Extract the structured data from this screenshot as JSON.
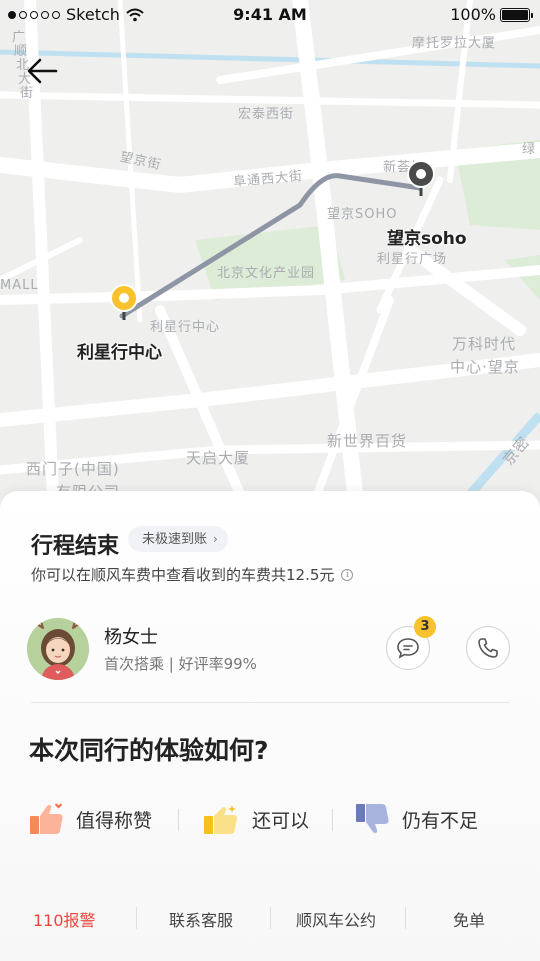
{
  "status_bar": {
    "carrier": "Sketch",
    "time": "9:41 AM",
    "battery": "100%"
  },
  "icons": {
    "back": "arrow-left-icon",
    "chat": "chat-bubble-icon",
    "phone": "phone-icon",
    "info": "info-icon",
    "praise": "thumbs-up-icon",
    "ok": "ok-hand-icon",
    "lacking": "thumbs-down-icon"
  },
  "map": {
    "labels": {
      "motorola": "摩托罗拉大厦",
      "hongtai": "宏泰西街",
      "wangjing_st": "望京街",
      "futong": "阜通西大街",
      "wangjing_soho_road": "望京SOHO",
      "xinye": "新荟城",
      "lixing_plaza": "利星行广场",
      "culture_park": "北京文化产业园",
      "mall": "MALL",
      "lixing_center_road": "利星行中心",
      "vanke": "万科时代",
      "vanke2": "中心·望京",
      "new_world": "新世界百货",
      "tianqi": "天启大厦",
      "ximenzi": "西门子(中国)",
      "ximenzi2": "有限公司",
      "jingmi": "京密",
      "beida_1": "广",
      "beida_2": "顺",
      "beida_3": "北",
      "beida_4": "大",
      "beida_5": "街",
      "lu": "绿"
    },
    "origin_label": "利星行中心",
    "destination_label": "望京soho",
    "colors": {
      "route": "#8e96a5",
      "origin_pin": "#f7c22b",
      "destination_pin": "#4a4a4a",
      "water": "#bfe0f1",
      "green": "#d9ead2"
    }
  },
  "sheet": {
    "title": "行程结束",
    "tag": "未极速到账",
    "tag_chevron": "›",
    "fee_text": "你可以在顺风车费中查看收到的车费共12.5元",
    "info_glyph": "i",
    "driver": {
      "name": "杨女士",
      "subtitle": "首次搭乘 | 好评率99%",
      "unread_count": "3"
    },
    "question": "本次同行的体验如何?",
    "ratings": [
      {
        "label": "值得称赞"
      },
      {
        "label": "还可以"
      },
      {
        "label": "仍有不足"
      }
    ],
    "footer": [
      {
        "label": "110报警"
      },
      {
        "label": "联系客服"
      },
      {
        "label": "顺风车公约"
      },
      {
        "label": "免单"
      }
    ],
    "colors": {
      "alert": "#e8483c",
      "badge": "#f7c22b"
    }
  }
}
